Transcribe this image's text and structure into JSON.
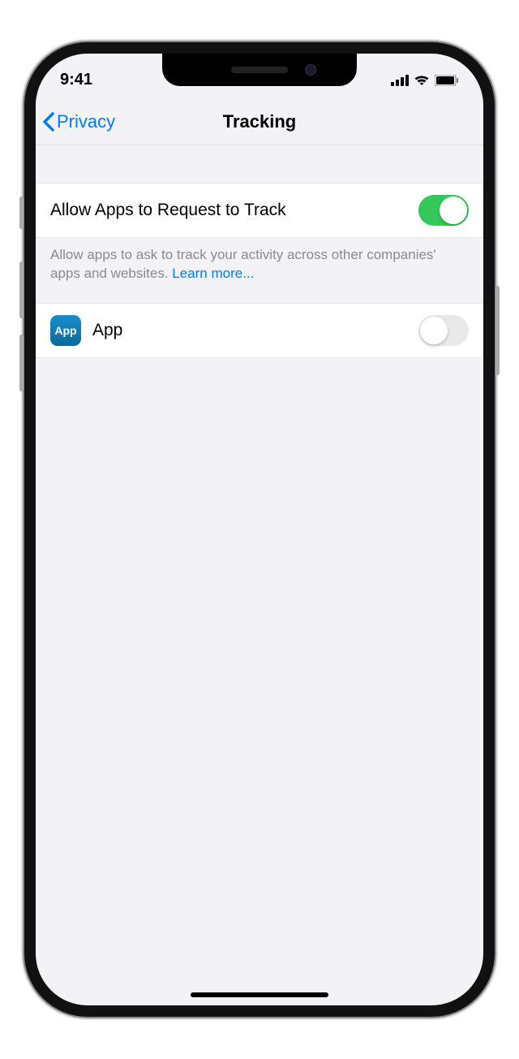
{
  "status": {
    "time": "9:41"
  },
  "nav": {
    "back_label": "Privacy",
    "title": "Tracking"
  },
  "settings": {
    "allow_label": "Allow Apps to Request to Track",
    "allow_on": true,
    "footer_text": "Allow apps to ask to track your activity across other companies' apps and websites. ",
    "learn_more": "Learn more...",
    "app": {
      "icon_label": "App",
      "name": "App",
      "on": false
    }
  }
}
